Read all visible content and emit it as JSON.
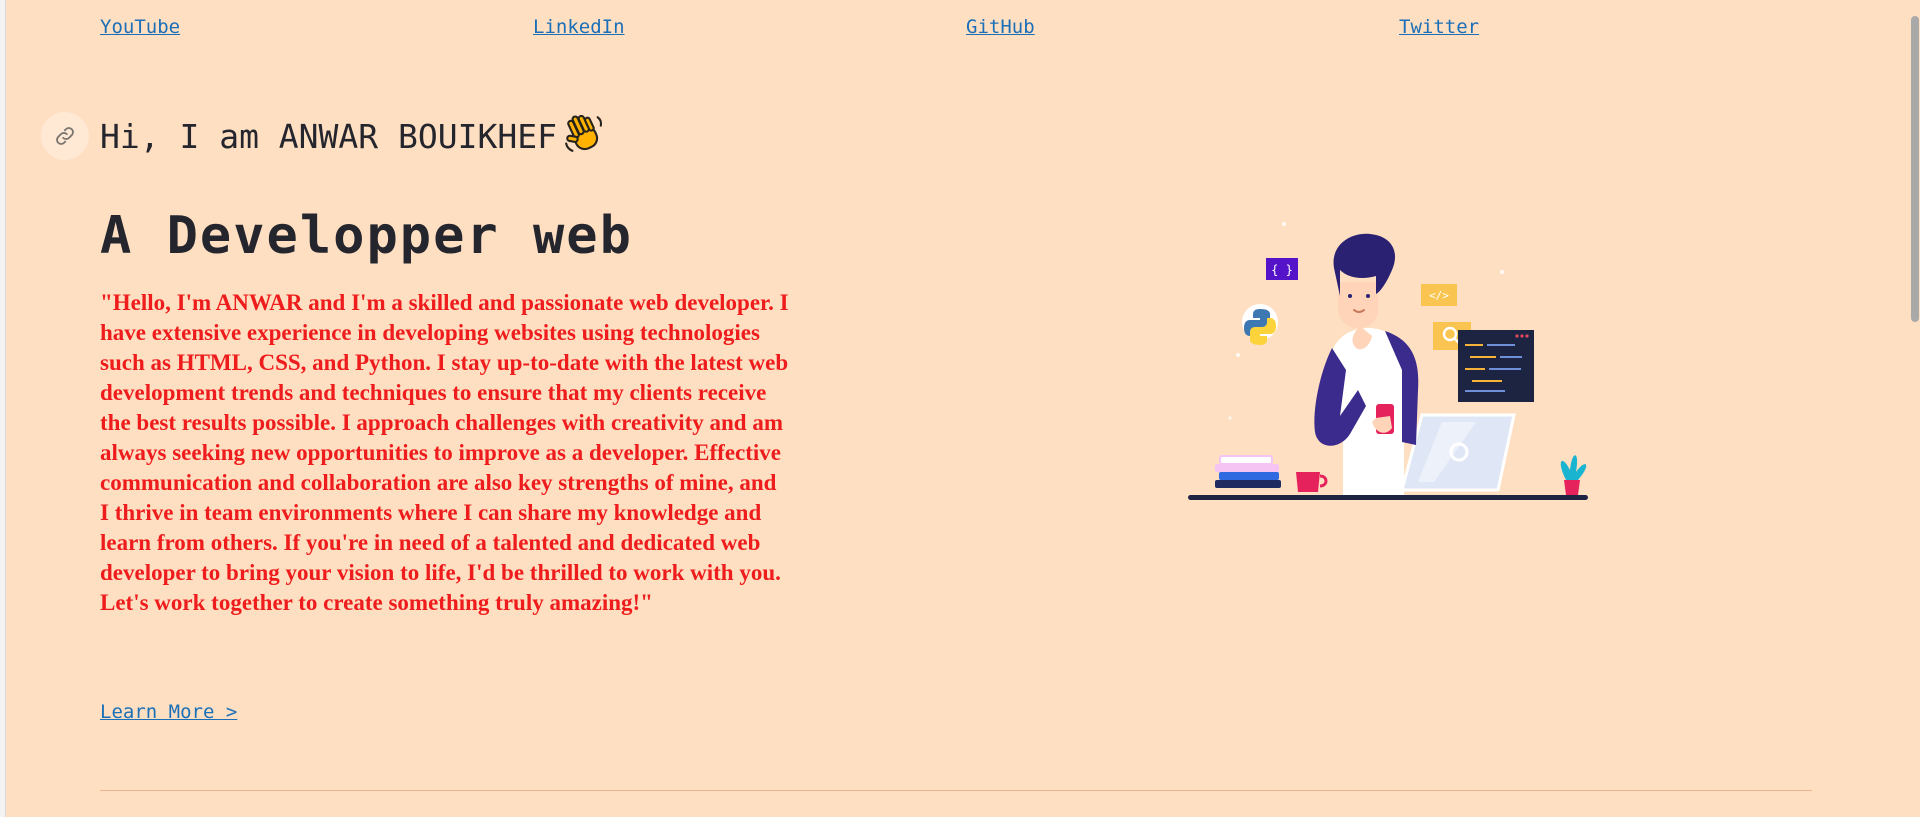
{
  "nav": {
    "links": [
      {
        "label": "YouTube"
      },
      {
        "label": "LinkedIn"
      },
      {
        "label": "GitHub"
      },
      {
        "label": "Twitter"
      }
    ]
  },
  "hero": {
    "greeting": "Hi, I am ANWAR BOUIKHEF",
    "role": "A Developper web",
    "bio": "\"Hello, I'm ANWAR and I'm a skilled and passionate web developer. I have extensive experience in developing websites using technologies such as HTML, CSS, and Python. I stay up-to-date with the latest web development trends and techniques to ensure that my clients receive the best results possible. I approach challenges with creativity and am always seeking new opportunities to improve as a developer. Effective communication and collaboration are also key strengths of mine, and I thrive in team environments where I can share my knowledge and learn from others. If you're in need of a talented and dedicated web developer to bring your vision to life, I'd be thrilled to work with you. Let's work together to create something truly amazing!\"",
    "learn_more": "Learn More >"
  },
  "illustration": {
    "braces_tag": "{ }",
    "code_tag": "</>"
  },
  "icons": {
    "anchor": "link-icon",
    "wave": "waving-hand-icon",
    "search": "search-icon",
    "python": "python-icon"
  },
  "colors": {
    "background": "#ffdfc1",
    "text": "#24252d",
    "link": "#1a6fb8",
    "bio": "#ee1c1c",
    "accent_purple": "#3b2b8c"
  }
}
